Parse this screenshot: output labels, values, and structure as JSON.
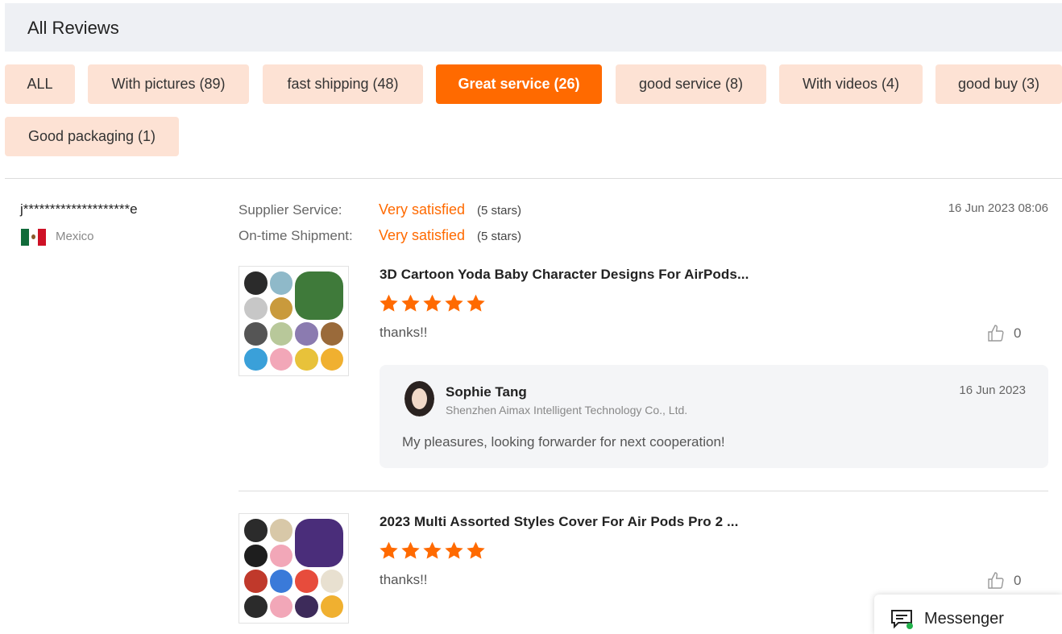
{
  "header": {
    "title": "All Reviews"
  },
  "filters": [
    {
      "label": "ALL",
      "active": false
    },
    {
      "label": "With pictures (89)",
      "active": false
    },
    {
      "label": "fast shipping (48)",
      "active": false
    },
    {
      "label": "Great service (26)",
      "active": true
    },
    {
      "label": "good service (8)",
      "active": false
    },
    {
      "label": "With videos (4)",
      "active": false
    },
    {
      "label": "good buy (3)",
      "active": false
    },
    {
      "label": "Good packaging (1)",
      "active": false
    }
  ],
  "review": {
    "username": "j********************e",
    "country": "Mexico",
    "date": "16 Jun 2023 08:06",
    "ratings": [
      {
        "label": "Supplier Service:",
        "value": "Very satisfied",
        "stars": "(5 stars)"
      },
      {
        "label": "On-time Shipment:",
        "value": "Very satisfied",
        "stars": "(5 stars)"
      }
    ],
    "products": [
      {
        "title": "3D Cartoon Yoda Baby Character Designs For AirPods...",
        "rating": 5,
        "text": "thanks!!",
        "likes": "0"
      },
      {
        "title": "2023 Multi Assorted Styles Cover For Air Pods Pro 2 ...",
        "rating": 5,
        "text": "thanks!!",
        "likes": "0"
      }
    ],
    "reply": {
      "name": "Sophie Tang",
      "company": "Shenzhen Aimax Intelligent Technology Co., Ltd.",
      "date": "16 Jun 2023",
      "text": "My pleasures, looking forwarder for next cooperation!"
    }
  },
  "messenger": {
    "label": "Messenger"
  },
  "colors": {
    "accent": "#ff6a00",
    "chip_bg": "#fde2d4",
    "header_bg": "#eef0f4",
    "reply_bg": "#f4f5f7",
    "online": "#22b14c"
  }
}
